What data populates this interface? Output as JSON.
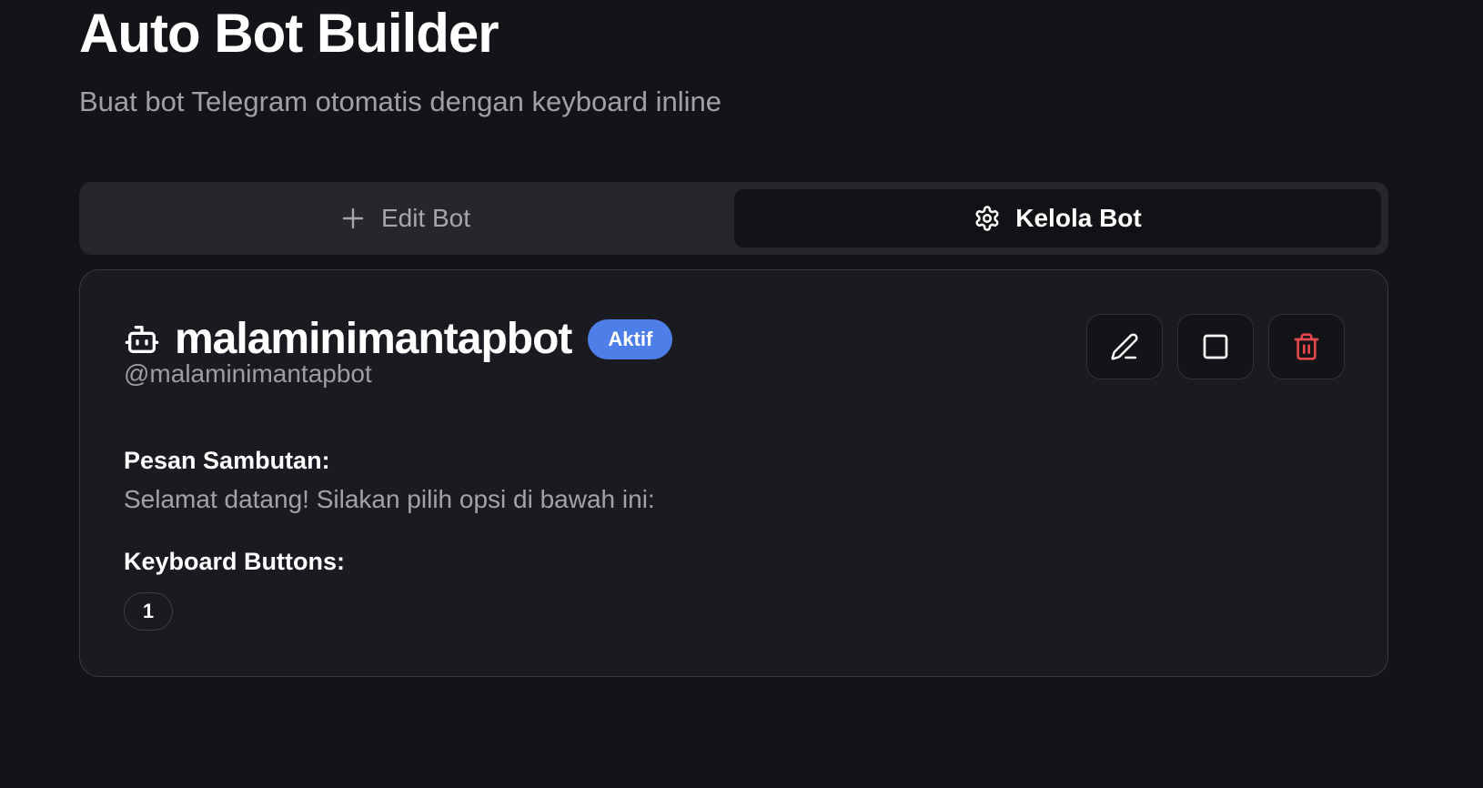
{
  "header": {
    "title": "Auto Bot Builder",
    "subtitle": "Buat bot Telegram otomatis dengan keyboard inline"
  },
  "tabs": [
    {
      "label": "Edit Bot",
      "icon": "plus-icon",
      "active": false
    },
    {
      "label": "Kelola Bot",
      "icon": "gear-icon",
      "active": true
    }
  ],
  "bot": {
    "name": "malaminimantapbot",
    "status": "Aktif",
    "username": "@malaminimantapbot",
    "welcome_label": "Pesan Sambutan:",
    "welcome_message": "Selamat datang! Silakan pilih opsi di bawah ini:",
    "keyboard_label": "Keyboard Buttons:",
    "keyboard_buttons": [
      "1"
    ]
  },
  "actions": [
    {
      "icon": "pencil-icon"
    },
    {
      "icon": "square-icon"
    },
    {
      "icon": "trash-icon"
    }
  ],
  "colors": {
    "background": "#131318",
    "card": "#1a1a20",
    "badge": "#4e7ee8",
    "danger": "#e5484d"
  }
}
